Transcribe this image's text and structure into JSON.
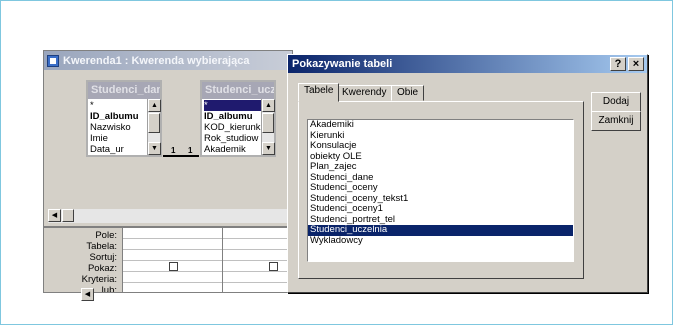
{
  "query_window": {
    "title": "Kwerenda1 : Kwerenda wybierająca",
    "tables": [
      {
        "name": "Studenci_dane",
        "fields": [
          "*",
          "ID_albumu",
          "Nazwisko",
          "Imie",
          "Data_ur"
        ]
      },
      {
        "name": "Studenci_ucz",
        "fields": [
          "*",
          "ID_albumu",
          "KOD_kierunku",
          "Rok_studiow",
          "Akademik"
        ]
      }
    ],
    "relation": {
      "left": "1",
      "right": "1"
    },
    "grid_labels": [
      "Pole:",
      "Tabela:",
      "Sortuj:",
      "Pokaz:",
      "Kryteria:",
      "lub:"
    ]
  },
  "dialog": {
    "title": "Pokazywanie tabeli",
    "help_label": "?",
    "close_label": "×",
    "tabs": [
      "Tabele",
      "Kwerendy",
      "Obie"
    ],
    "items": [
      "Akademiki",
      "Kierunki",
      "Konsulacje",
      "obiekty OLE",
      "Plan_zajec",
      "Studenci_dane",
      "Studenci_oceny",
      "Studenci_oceny_tekst1",
      "Studenci_oceny1",
      "Studenci_portret_tel",
      "Studenci_uczelnia",
      "Wykladowcy"
    ],
    "selected_item": "Studenci_uczelnia",
    "add_label": "Dodaj",
    "close_button_label": "Zamknij"
  },
  "icons": {
    "app": "query-window-icon",
    "scroll_up": "arrow-up-icon",
    "scroll_down": "arrow-down-icon",
    "scroll_left": "arrow-left-icon",
    "checkbox": "checkbox-icon"
  },
  "colors": {
    "dialog_title": "#0a246a",
    "selection": "#0a246a",
    "face": "#d4d0c8"
  }
}
